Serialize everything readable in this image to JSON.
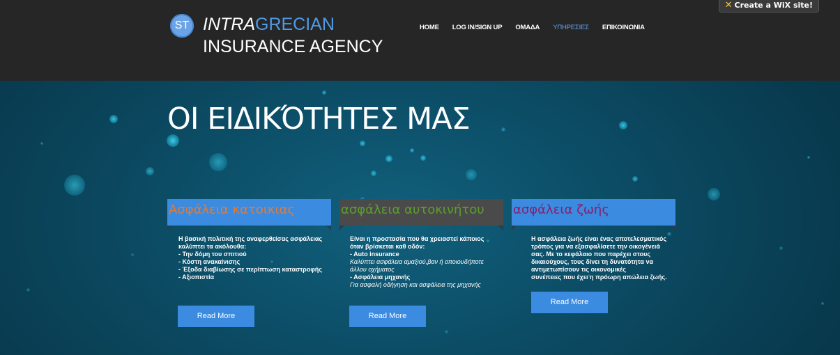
{
  "wix_banner": {
    "label": "Create a WiX  site!"
  },
  "brand": {
    "badge": "ST",
    "line1_italic": "INTRA",
    "line1_rest": "GRECIAN",
    "line2": "INSURANCE AGENCY"
  },
  "nav": [
    {
      "label": "HOME",
      "active": false
    },
    {
      "label": "LOG IN/SIGN UP",
      "active": false
    },
    {
      "label": "ΟΜΑΔΑ",
      "active": false
    },
    {
      "label": "ΥΠΗΡΕΣΙΕΣ",
      "active": true
    },
    {
      "label": "ΕΠΙΚΟΙΝΩΝΙΑ",
      "active": false
    }
  ],
  "hero": {
    "title": "ΟΙ ΕΙΔΙΚΌΤΗΤΕΣ ΜΑΣ"
  },
  "cards": [
    {
      "title": "Ασφάλεια κατοικιας",
      "title_color": "#e87a2f",
      "head_bg": "#3b8be0",
      "lines": [
        {
          "text": "Η βασική πολιτική της αναφερθείσας ασφάλειας",
          "italic": false
        },
        {
          "text": "καλύπτει τα ακόλουθα:",
          "italic": false
        },
        {
          "text": "- Την δόμη του σπιτιού",
          "italic": false
        },
        {
          "text": "- Κόστη ανακαίνισης",
          "italic": false
        },
        {
          "text": "- Έξοδα διαβίωσης σε περίπτωση καταστροφής",
          "italic": false
        },
        {
          "text": "- Αξιοπιστία",
          "italic": false
        }
      ],
      "button": "Read More"
    },
    {
      "title": "ασφάλεια αυτοκινήτου",
      "title_color": "#5aa02c",
      "head_bg": "#4a4a4a",
      "lines": [
        {
          "text": "Είναι η προστασία που θα χρειαστεί κάποιος",
          "italic": false
        },
        {
          "text": "όταν βρίσκεται καθ οδόν:",
          "italic": false
        },
        {
          "text": "- Auto insurance",
          "italic": false
        },
        {
          "text": "Καλύπτει ασφάλεια αμαξιού,βαν ή οποιουδήποτε",
          "italic": true
        },
        {
          "text": "άλλου οχήματος",
          "italic": true
        },
        {
          "text": "- Ασφάλεια μηχανής",
          "italic": false
        },
        {
          "text": "Για ασφαλή οδήγηση και ασφάλεια της μηχανής",
          "italic": true
        }
      ],
      "button": "Read More"
    },
    {
      "title": "ασφάλεια ζωής",
      "title_color": "#8a1e6e",
      "head_bg": "#3b8be0",
      "lines": [
        {
          "text": "Η ασφάλεια ζωής είναι ένας αποτελεσματικός",
          "italic": false
        },
        {
          "text": "τρόπος για να εξασφαλίσετε την οικογένειά",
          "italic": false
        },
        {
          "text": "σας. Με το κεφάλαιο που παρέχει στους",
          "italic": false
        },
        {
          "text": "δικαιούχους, τους δίνει τη δυνατότητα να",
          "italic": false
        },
        {
          "text": "αντιμετωπίσουν τις οικονομικές",
          "italic": false
        },
        {
          "text": "συνέπειες που έχει η πρόωρη απώλεια ζωής.",
          "italic": false
        }
      ],
      "button": "Read More"
    }
  ]
}
